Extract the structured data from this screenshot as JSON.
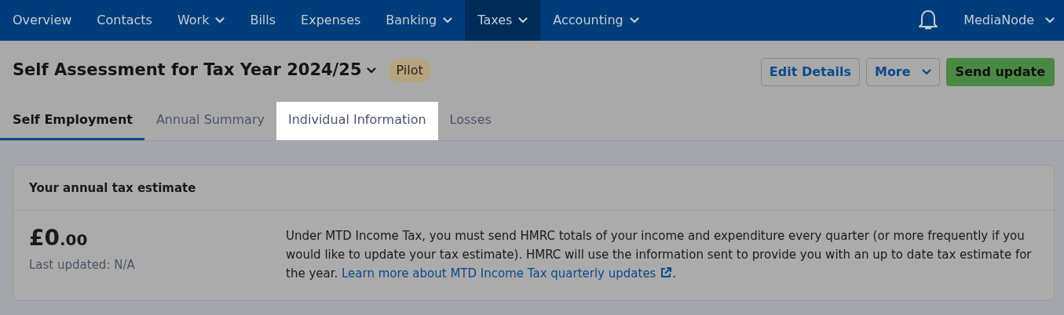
{
  "navbar": {
    "items": [
      {
        "label": "Overview",
        "has_menu": false,
        "selected": false
      },
      {
        "label": "Contacts",
        "has_menu": false,
        "selected": false
      },
      {
        "label": "Work",
        "has_menu": true,
        "selected": false
      },
      {
        "label": "Bills",
        "has_menu": false,
        "selected": false
      },
      {
        "label": "Expenses",
        "has_menu": false,
        "selected": false
      },
      {
        "label": "Banking",
        "has_menu": true,
        "selected": false
      },
      {
        "label": "Taxes",
        "has_menu": true,
        "selected": true
      },
      {
        "label": "Accounting",
        "has_menu": true,
        "selected": false
      }
    ],
    "account": "MediaNode"
  },
  "header": {
    "title": "Self Assessment for Tax Year 2024/25",
    "badge": "Pilot",
    "buttons": [
      {
        "label": "Edit Details",
        "kind": "outline"
      },
      {
        "label": "More",
        "kind": "dropdown"
      },
      {
        "label": "Send update",
        "kind": "primary"
      }
    ]
  },
  "tabs": [
    {
      "label": "Self Employment",
      "selected": true,
      "spotlighted": false
    },
    {
      "label": "Annual Summary",
      "selected": false,
      "spotlighted": false
    },
    {
      "label": "Individual Information",
      "selected": false,
      "spotlighted": true
    },
    {
      "label": "Losses",
      "selected": false,
      "spotlighted": false
    }
  ],
  "estimate_card": {
    "title": "Your annual tax estimate",
    "amount": {
      "whole": "£0",
      "fraction": ".00"
    },
    "last_updated": "Last updated: N/A",
    "description": "Under MTD Income Tax, you must send HMRC totals of your income and expenditure every quarter (or more frequently if you would like to update your tax estimate). HMRC will use the information sent to provide you with an up to date tax estimate for the year.",
    "link": "Learn more about MTD Income Tax quarterly updates",
    "after_link": "."
  }
}
